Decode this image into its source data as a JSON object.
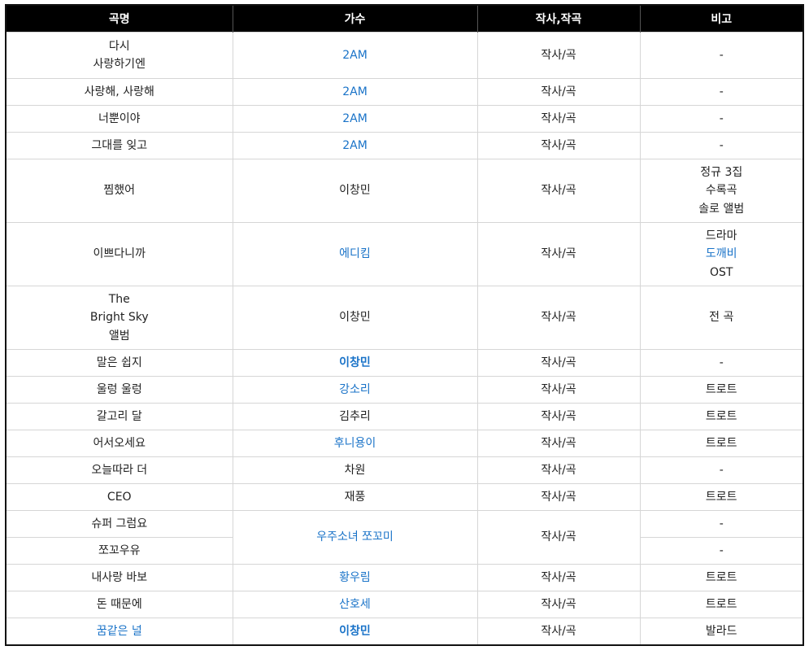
{
  "headers": {
    "title": "곡명",
    "singer": "가수",
    "credit": "작사,작곡",
    "note": "비고"
  },
  "rows": [
    {
      "title_lines": [
        "다시",
        "사랑하기엔"
      ],
      "singer": "2AM",
      "credit": "작사/곡",
      "note_lines": [
        "-"
      ]
    },
    {
      "title_lines": [
        "사랑해, 사랑해"
      ],
      "singer": "2AM",
      "credit": "작사/곡",
      "note_lines": [
        "-"
      ]
    },
    {
      "title_lines": [
        "너뿐이야"
      ],
      "singer": "2AM",
      "credit": "작사/곡",
      "note_lines": [
        "-"
      ]
    },
    {
      "title_lines": [
        "그대를 잊고"
      ],
      "singer": "2AM",
      "credit": "작사/곡",
      "note_lines": [
        "-"
      ]
    },
    {
      "title_lines": [
        "찜했어"
      ],
      "singer": "이창민",
      "credit": "작사/곡",
      "note_lines": [
        "정규 3집",
        "수록곡",
        "솔로 앨범"
      ]
    },
    {
      "title_lines": [
        "이쁘다니까"
      ],
      "singer": "에디킴",
      "credit": "작사/곡",
      "note_lines": [
        "드라마",
        "도깨비",
        "OST"
      ]
    },
    {
      "title_lines": [
        "The",
        "Bright Sky",
        "앨범"
      ],
      "singer": "이창민",
      "credit": "작사/곡",
      "note_lines": [
        "전 곡"
      ]
    },
    {
      "title_lines": [
        "말은 쉽지"
      ],
      "singer": "이창민",
      "credit": "작사/곡",
      "note_lines": [
        "-"
      ]
    },
    {
      "title_lines": [
        "울렁 울렁"
      ],
      "singer": "강소리",
      "credit": "작사/곡",
      "note_lines": [
        "트로트"
      ]
    },
    {
      "title_lines": [
        "갈고리 달"
      ],
      "singer": "김추리",
      "credit": "작사/곡",
      "note_lines": [
        "트로트"
      ]
    },
    {
      "title_lines": [
        "어서오세요"
      ],
      "singer": "후니용이",
      "credit": "작사/곡",
      "note_lines": [
        "트로트"
      ]
    },
    {
      "title_lines": [
        "오늘따라 더"
      ],
      "singer": "차원",
      "credit": "작사/곡",
      "note_lines": [
        "-"
      ]
    },
    {
      "title_lines": [
        "CEO"
      ],
      "singer": "재풍",
      "credit": "작사/곡",
      "note_lines": [
        "트로트"
      ]
    },
    {
      "title_lines": [
        "슈퍼 그럼요"
      ],
      "singer": "우주소녀 쪼꼬미",
      "credit": "작사/곡",
      "note_lines": [
        "-"
      ]
    },
    {
      "title_lines": [
        "쪼꼬우유"
      ],
      "note_lines": [
        "-"
      ]
    },
    {
      "title_lines": [
        "내사랑 바보"
      ],
      "singer": "황우림",
      "credit": "작사/곡",
      "note_lines": [
        "트로트"
      ]
    },
    {
      "title_lines": [
        "돈 때문에"
      ],
      "singer": "산호세",
      "credit": "작사/곡",
      "note_lines": [
        "트로트"
      ]
    },
    {
      "title_lines": [
        "꿈같은 널"
      ],
      "singer": "이창민",
      "credit": "작사/곡",
      "note_lines": [
        "발라드"
      ]
    }
  ],
  "colors": {
    "header_bg": "#000000",
    "header_text": "#ffffff",
    "link": "#1a73c8",
    "text": "#222222",
    "grid": "#d6d6d6"
  }
}
